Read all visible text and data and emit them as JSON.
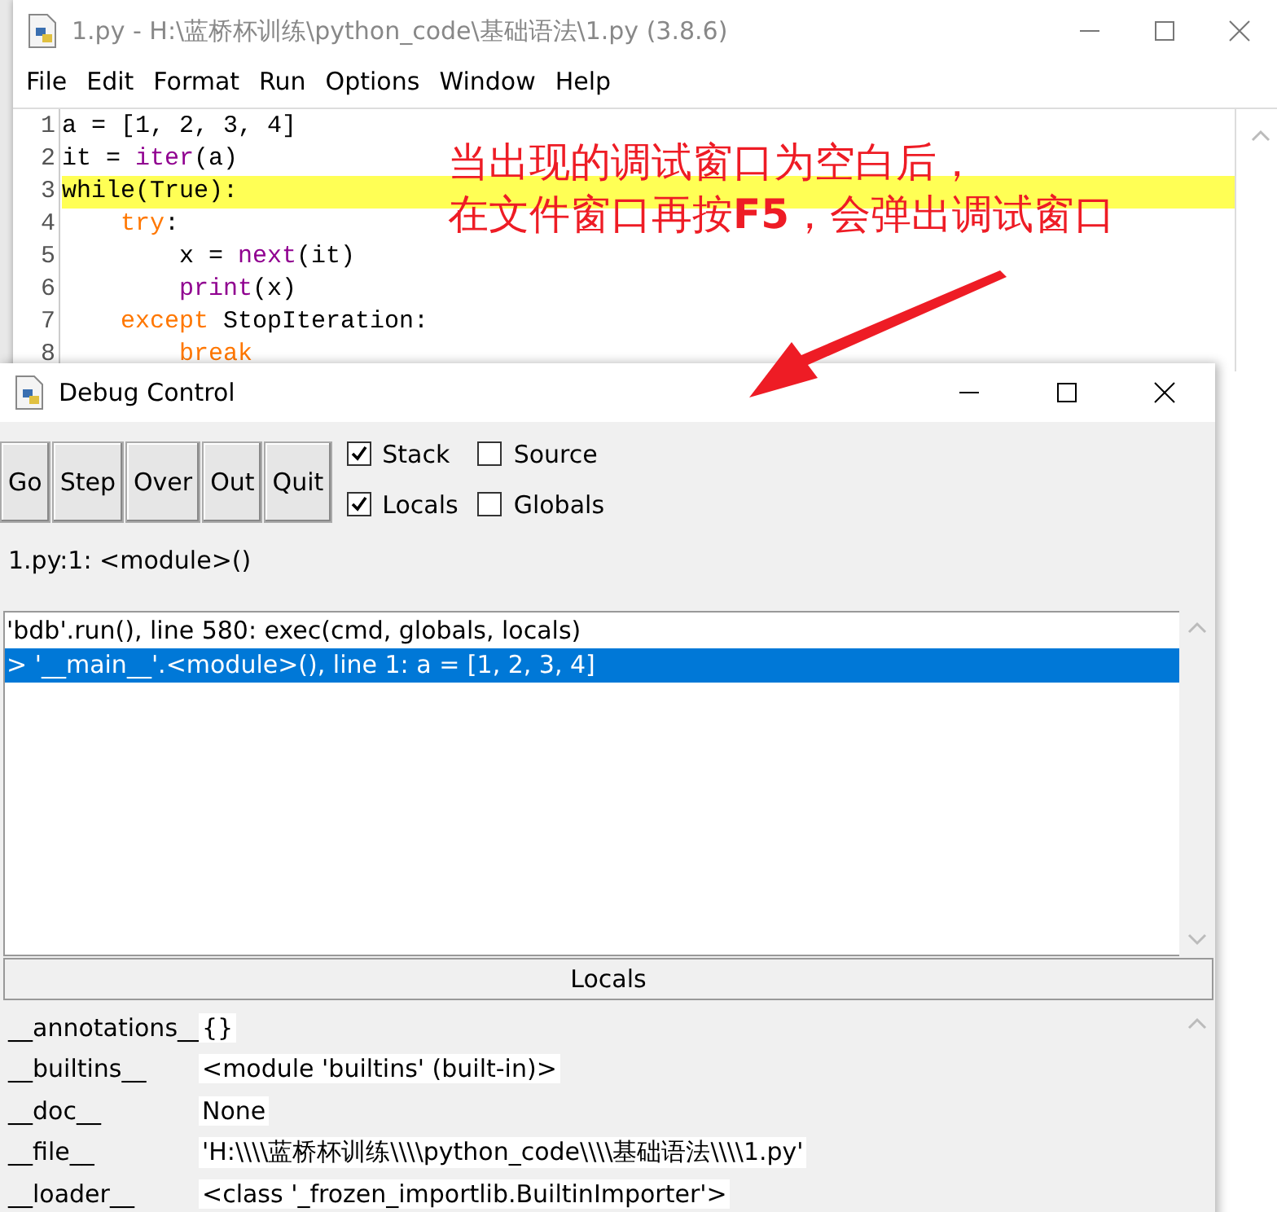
{
  "editor": {
    "title": "1.py - H:\\蓝桥杯训练\\python_code\\基础语法\\1.py (3.8.6)",
    "menu": [
      "File",
      "Edit",
      "Format",
      "Run",
      "Options",
      "Window",
      "Help"
    ],
    "lines": [
      {
        "number": "1",
        "highlighted": false,
        "tokens": [
          {
            "kind": "plain",
            "text": "a = [1, 2, 3, 4]"
          }
        ]
      },
      {
        "number": "2",
        "highlighted": false,
        "tokens": [
          {
            "kind": "plain",
            "text": "it = "
          },
          {
            "kind": "builtin",
            "text": "iter"
          },
          {
            "kind": "plain",
            "text": "(a)"
          }
        ]
      },
      {
        "number": "3",
        "highlighted": true,
        "tokens": [
          {
            "kind": "plain",
            "text": "while(True):"
          }
        ]
      },
      {
        "number": "4",
        "highlighted": false,
        "tokens": [
          {
            "kind": "keyword",
            "text": "    try"
          },
          {
            "kind": "plain",
            "text": ":"
          }
        ]
      },
      {
        "number": "5",
        "highlighted": false,
        "tokens": [
          {
            "kind": "plain",
            "text": "        x = "
          },
          {
            "kind": "builtin",
            "text": "next"
          },
          {
            "kind": "plain",
            "text": "(it)"
          }
        ]
      },
      {
        "number": "6",
        "highlighted": false,
        "tokens": [
          {
            "kind": "builtin",
            "text": "        print"
          },
          {
            "kind": "plain",
            "text": "(x)"
          }
        ]
      },
      {
        "number": "7",
        "highlighted": false,
        "tokens": [
          {
            "kind": "keyword",
            "text": "    except"
          },
          {
            "kind": "plain",
            "text": " StopIteration:"
          }
        ]
      },
      {
        "number": "8",
        "highlighted": false,
        "tokens": [
          {
            "kind": "keyword",
            "text": "        break"
          }
        ]
      }
    ]
  },
  "annotation": [
    "当出现的调试窗口为空白后，",
    "在文件窗口再按**F5**，会弹出调试窗口"
  ],
  "debug": {
    "title": "Debug Control",
    "buttons": [
      "Go",
      "Step",
      "Over",
      "Out",
      "Quit"
    ],
    "checkboxes": [
      {
        "label": "Stack",
        "checked": true
      },
      {
        "label": "Source",
        "checked": false
      },
      {
        "label": "Locals",
        "checked": true
      },
      {
        "label": "Globals",
        "checked": false
      }
    ],
    "status": "1.py:1: <module>()",
    "stack": [
      {
        "text": "'bdb'.run(), line 580: exec(cmd, globals, locals)",
        "selected": false
      },
      {
        "text": "> '__main__'.<module>(), line 1: a = [1, 2, 3, 4]",
        "selected": true
      }
    ],
    "locals_title": "Locals",
    "locals": [
      {
        "name": "__annotations__",
        "value": "{}"
      },
      {
        "name": "__builtins__",
        "value": "<module 'builtins' (built-in)>"
      },
      {
        "name": "__doc__",
        "value": "None"
      },
      {
        "name": "__file__",
        "value": "'H:\\\\\\\\蓝桥杯训练\\\\\\\\python_code\\\\\\\\基础语法\\\\\\\\1.py'"
      },
      {
        "name": "__loader__",
        "value": "<class '_frozen_importlib.BuiltinImporter'>"
      }
    ]
  }
}
